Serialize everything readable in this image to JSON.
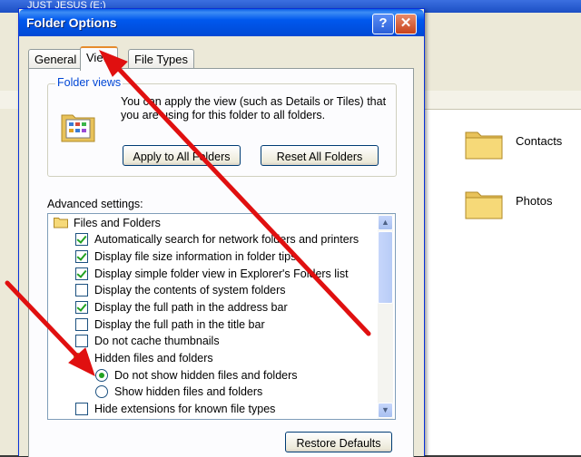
{
  "background": {
    "title": "JUST JESUS (E:)",
    "files": [
      {
        "name": "Contacts",
        "icon": "folder-icon"
      },
      {
        "name": "Photos",
        "icon": "folder-icon"
      }
    ]
  },
  "dialog": {
    "title": "Folder Options",
    "help_label": "?",
    "close_label": "✕",
    "tabs": [
      {
        "label": "General"
      },
      {
        "label": "View",
        "active": true
      },
      {
        "label": "File Types"
      }
    ],
    "folder_views": {
      "legend": "Folder views",
      "description": "You can apply the view (such as Details or Tiles) that you are using for this folder to all folders.",
      "apply_label": "Apply to All Folders",
      "reset_label": "Reset All Folders"
    },
    "advanced_label": "Advanced settings:",
    "advanced_items": [
      {
        "type": "folder",
        "label": "Files and Folders"
      },
      {
        "type": "checkbox",
        "checked": true,
        "label": "Automatically search for network folders and printers"
      },
      {
        "type": "checkbox",
        "checked": true,
        "label": "Display file size information in folder tips"
      },
      {
        "type": "checkbox",
        "checked": true,
        "label": "Display simple folder view in Explorer's Folders list"
      },
      {
        "type": "checkbox",
        "checked": false,
        "label": "Display the contents of system folders"
      },
      {
        "type": "checkbox",
        "checked": true,
        "label": "Display the full path in the address bar"
      },
      {
        "type": "checkbox",
        "checked": false,
        "label": "Display the full path in the title bar"
      },
      {
        "type": "checkbox",
        "checked": false,
        "label": "Do not cache thumbnails"
      },
      {
        "type": "folder",
        "label": "Hidden files and folders"
      },
      {
        "type": "radio",
        "selected": true,
        "label": "Do not show hidden files and folders"
      },
      {
        "type": "radio",
        "selected": false,
        "label": "Show hidden files and folders"
      },
      {
        "type": "checkbox",
        "checked": false,
        "label": "Hide extensions for known file types"
      }
    ],
    "restore_label": "Restore Defaults"
  },
  "colors": {
    "title_bar": "#0058ee",
    "accent": "#e68b2c",
    "check": "#21a121",
    "annotation_arrow": "#e01010"
  }
}
